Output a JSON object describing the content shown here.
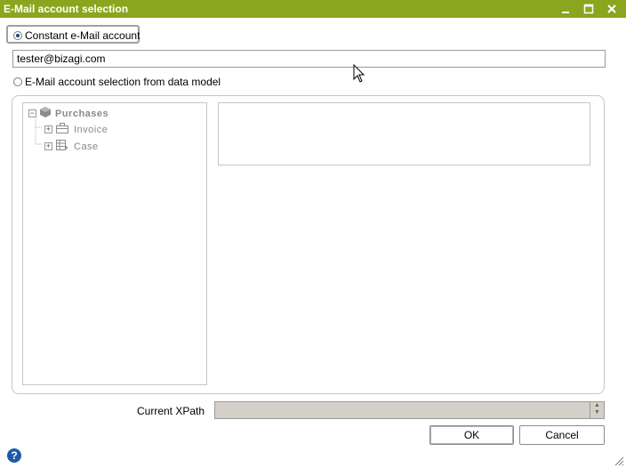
{
  "window": {
    "title": "E-Mail account selection",
    "minimize_icon": "minimize-icon",
    "maximize_icon": "maximize-icon",
    "close_icon": "close-icon"
  },
  "options": {
    "constant_label": "Constant e-Mail account",
    "constant_selected": true,
    "email_value": "tester@bizagi.com",
    "datamodel_label": "E-Mail account selection from data model",
    "datamodel_selected": false
  },
  "tree": {
    "root": {
      "label": "Purchases",
      "icon": "entity-cube-icon"
    },
    "children": [
      {
        "label": "Invoice",
        "icon": "briefcase-icon"
      },
      {
        "label": "Case",
        "icon": "table-icon"
      }
    ]
  },
  "xpath": {
    "label": "Current XPath",
    "value": ""
  },
  "buttons": {
    "ok": "OK",
    "cancel": "Cancel"
  },
  "help_icon": "help-icon"
}
